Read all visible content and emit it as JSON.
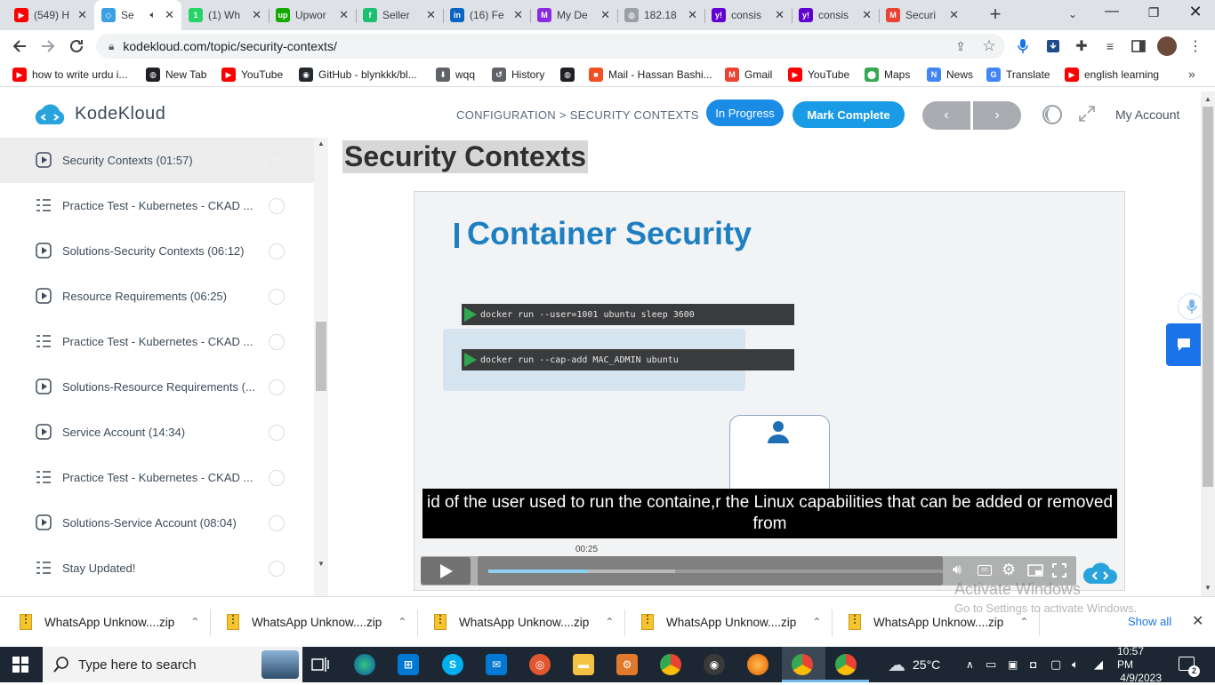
{
  "browser": {
    "tabs": [
      {
        "title": "(549) H",
        "icon": "youtube-icon",
        "color": "#ff0000",
        "glyph": "▶"
      },
      {
        "title": "Se",
        "icon": "kodekloud-icon",
        "color": "#3aa0e3",
        "glyph": "◇",
        "active": true
      },
      {
        "title": "(1) Wh",
        "icon": "whatsapp-icon",
        "color": "#25d366",
        "glyph": "1"
      },
      {
        "title": "Upwor",
        "icon": "upwork-icon",
        "color": "#14a800",
        "glyph": "up"
      },
      {
        "title": "Seller",
        "icon": "fiverr-icon",
        "color": "#1dbf73",
        "glyph": "f"
      },
      {
        "title": "(16) Fe",
        "icon": "linkedin-icon",
        "color": "#0a66c2",
        "glyph": "in"
      },
      {
        "title": "My De",
        "icon": "site-icon",
        "color": "#8a2be2",
        "glyph": "M"
      },
      {
        "title": "182.18",
        "icon": "globe-icon",
        "color": "#9aa0a6",
        "glyph": "◍"
      },
      {
        "title": "consis",
        "icon": "yahoo-icon",
        "color": "#6001d2",
        "glyph": "y!"
      },
      {
        "title": "consis",
        "icon": "yahoo-icon",
        "color": "#6001d2",
        "glyph": "y!"
      },
      {
        "title": "Securi",
        "icon": "gmail-icon",
        "color": "#ea4335",
        "glyph": "M"
      }
    ],
    "url": "kodekloud.com/topic/security-contexts/",
    "bookmarks": [
      {
        "label": "how to write urdu i...",
        "icon": "youtube-icon",
        "color": "#ff0000"
      },
      {
        "label": "New Tab",
        "icon": "globe-icon",
        "color": "#202124"
      },
      {
        "label": "YouTube",
        "icon": "youtube-icon",
        "color": "#ff0000"
      },
      {
        "label": "GitHub - blynkkk/bl...",
        "icon": "github-icon",
        "color": "#24292e"
      },
      {
        "label": "wqq",
        "icon": "download-icon",
        "color": "#5f6368"
      },
      {
        "label": "History",
        "icon": "history-icon",
        "color": "#5f6368"
      },
      {
        "label": "",
        "icon": "globe-icon",
        "color": "#202124"
      },
      {
        "label": "Mail - Hassan Bashi...",
        "icon": "microsoft-icon",
        "color": "#f25022"
      },
      {
        "label": "Gmail",
        "icon": "gmail-icon",
        "color": "#ea4335"
      },
      {
        "label": "YouTube",
        "icon": "youtube-icon",
        "color": "#ff0000"
      },
      {
        "label": "Maps",
        "icon": "maps-icon",
        "color": "#34a853"
      },
      {
        "label": "News",
        "icon": "news-icon",
        "color": "#4285f4"
      },
      {
        "label": "Translate",
        "icon": "translate-icon",
        "color": "#4285f4"
      },
      {
        "label": "english learning",
        "icon": "youtube-icon",
        "color": "#ff0000"
      }
    ]
  },
  "header": {
    "logo": "KodeKloud",
    "breadcrumb": "CONFIGURATION > SECURITY CONTEXTS",
    "in_progress": "In Progress",
    "mark_complete": "Mark Complete",
    "prev": "‹",
    "next": "›",
    "my_account": "My Account"
  },
  "sidebar": {
    "items": [
      {
        "label": "Security Contexts (01:57)",
        "type": "video",
        "active": true
      },
      {
        "label": "Practice Test - Kubernetes - CKAD ...",
        "type": "quiz"
      },
      {
        "label": "Solutions-Security Contexts (06:12)",
        "type": "video"
      },
      {
        "label": "Resource Requirements (06:25)",
        "type": "video"
      },
      {
        "label": "Practice Test - Kubernetes - CKAD ...",
        "type": "quiz"
      },
      {
        "label": "Solutions-Resource Requirements (...",
        "type": "video"
      },
      {
        "label": "Service Account (14:34)",
        "type": "video"
      },
      {
        "label": "Practice Test - Kubernetes - CKAD ...",
        "type": "quiz"
      },
      {
        "label": "Solutions-Service Account (08:04)",
        "type": "video"
      },
      {
        "label": "Stay Updated!",
        "type": "quiz"
      }
    ]
  },
  "main": {
    "title": "Security Contexts",
    "slide_title": "Container Security",
    "cmd1": "docker run --user=1001 ubuntu sleep 3600",
    "cmd2": "docker run --cap-add MAC_ADMIN  ubuntu",
    "caption": "id of the user used to run the containe,r the Linux capabilities that can be added or removed from",
    "time_tooltip": "00:25",
    "progress": 0.22,
    "buffered": 0.41,
    "watermark_1": "Activate Windows",
    "watermark_2": "Go to Settings to activate Windows."
  },
  "downloads": {
    "items": [
      "WhatsApp Unknow....zip",
      "WhatsApp Unknow....zip",
      "WhatsApp Unknow....zip",
      "WhatsApp Unknow....zip",
      "WhatsApp Unknow....zip"
    ],
    "show_all": "Show all"
  },
  "taskbar": {
    "search_placeholder": "Type here to search",
    "temperature": "25°C",
    "time": "10:57 PM",
    "date": "4/9/2023",
    "notifications": "2"
  },
  "colors": {
    "brand_blue": "#1e88e5",
    "mark_complete": "#1a9be6",
    "in_progress": "#1b8ce6",
    "slide_blue": "#1e7fc1"
  }
}
